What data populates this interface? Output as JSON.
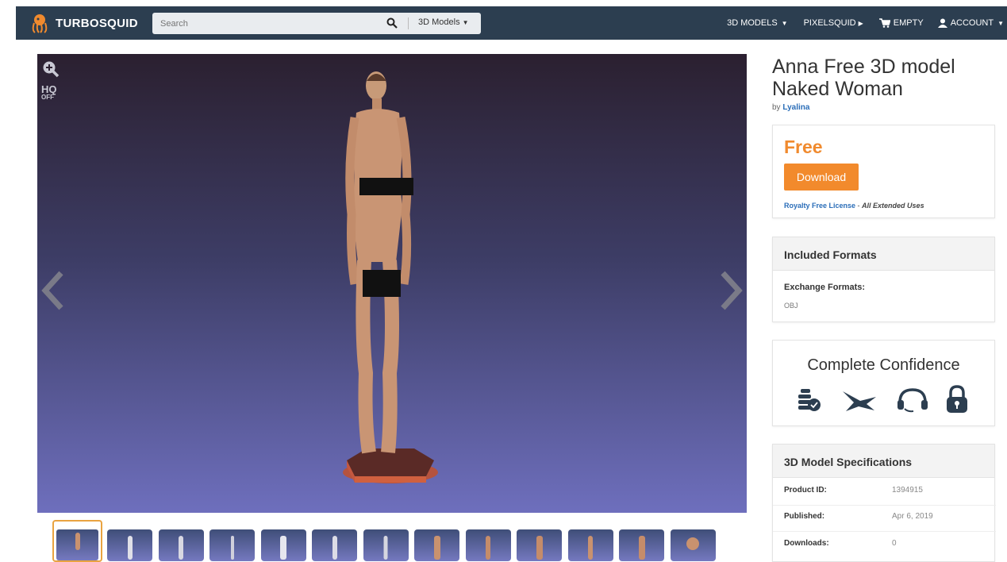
{
  "header": {
    "brand": "TURBOSQUID",
    "search_placeholder": "Search",
    "category_dropdown": "3D Models",
    "nav": {
      "models": "3D MODELS",
      "pixelsquid": "PIXELSQUID",
      "cart": "EMPTY",
      "account": "ACCOUNT"
    }
  },
  "viewer": {
    "hq_label": "HQ",
    "hq_state": "OFF",
    "thumbnail_count": 13,
    "active_thumbnail": 1
  },
  "product": {
    "title": "Anna Free 3D model Naked Woman",
    "by_prefix": "by",
    "author": "Lyalina",
    "price": "Free",
    "download_label": "Download",
    "license_link": "Royalty Free License",
    "license_separator": " - ",
    "license_note": "All Extended Uses"
  },
  "formats": {
    "heading": "Included Formats",
    "exchange_label": "Exchange Formats:",
    "exchange_values": "OBJ"
  },
  "confidence": {
    "heading": "Complete Confidence",
    "icons": [
      "money-coins-icon",
      "bird-icon",
      "headset-icon",
      "lock-icon"
    ]
  },
  "specs": {
    "heading": "3D Model Specifications",
    "rows": [
      {
        "key": "Product ID:",
        "value": "1394915"
      },
      {
        "key": "Published:",
        "value": "Apr 6, 2019"
      },
      {
        "key": "Downloads:",
        "value": "0"
      }
    ]
  },
  "colors": {
    "navbar": "#2c3e50",
    "accent_orange": "#f28a2c",
    "link_blue": "#2a6db8"
  }
}
